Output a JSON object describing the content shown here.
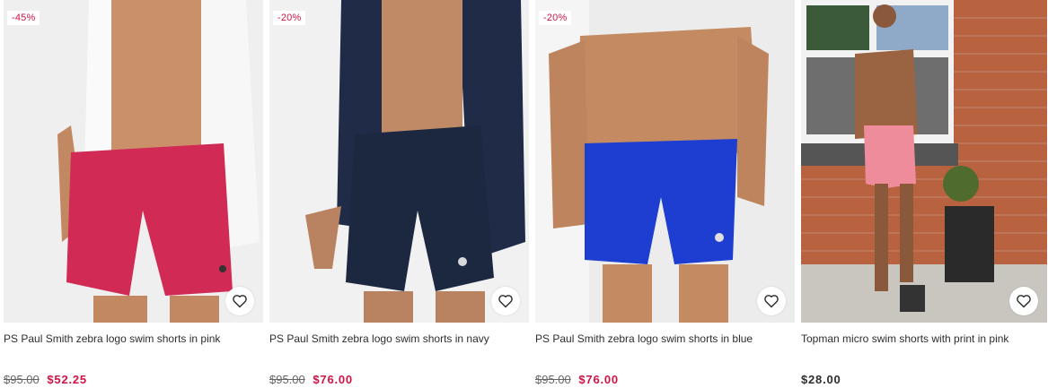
{
  "products": [
    {
      "badge": "-45%",
      "title": "PS Paul Smith zebra logo swim shorts in pink",
      "old_price": "$95.00",
      "price": "$52.25",
      "shorts_color": "#d02a55"
    },
    {
      "badge": "-20%",
      "title": "PS Paul Smith zebra logo swim shorts in navy",
      "old_price": "$95.00",
      "price": "$76.00",
      "shorts_color": "#1c2740"
    },
    {
      "badge": "-20%",
      "title": "PS Paul Smith zebra logo swim shorts in blue",
      "old_price": "$95.00",
      "price": "$76.00",
      "shorts_color": "#1d3ed0"
    },
    {
      "badge": "",
      "title": "Topman micro swim shorts with print in pink",
      "old_price": "",
      "price": "$28.00",
      "shorts_color": "#ee8c9c"
    }
  ],
  "colors": {
    "sale": "#d01345",
    "text": "#2d2d2d"
  },
  "icons": {
    "wishlist": "heart-outline-icon"
  }
}
